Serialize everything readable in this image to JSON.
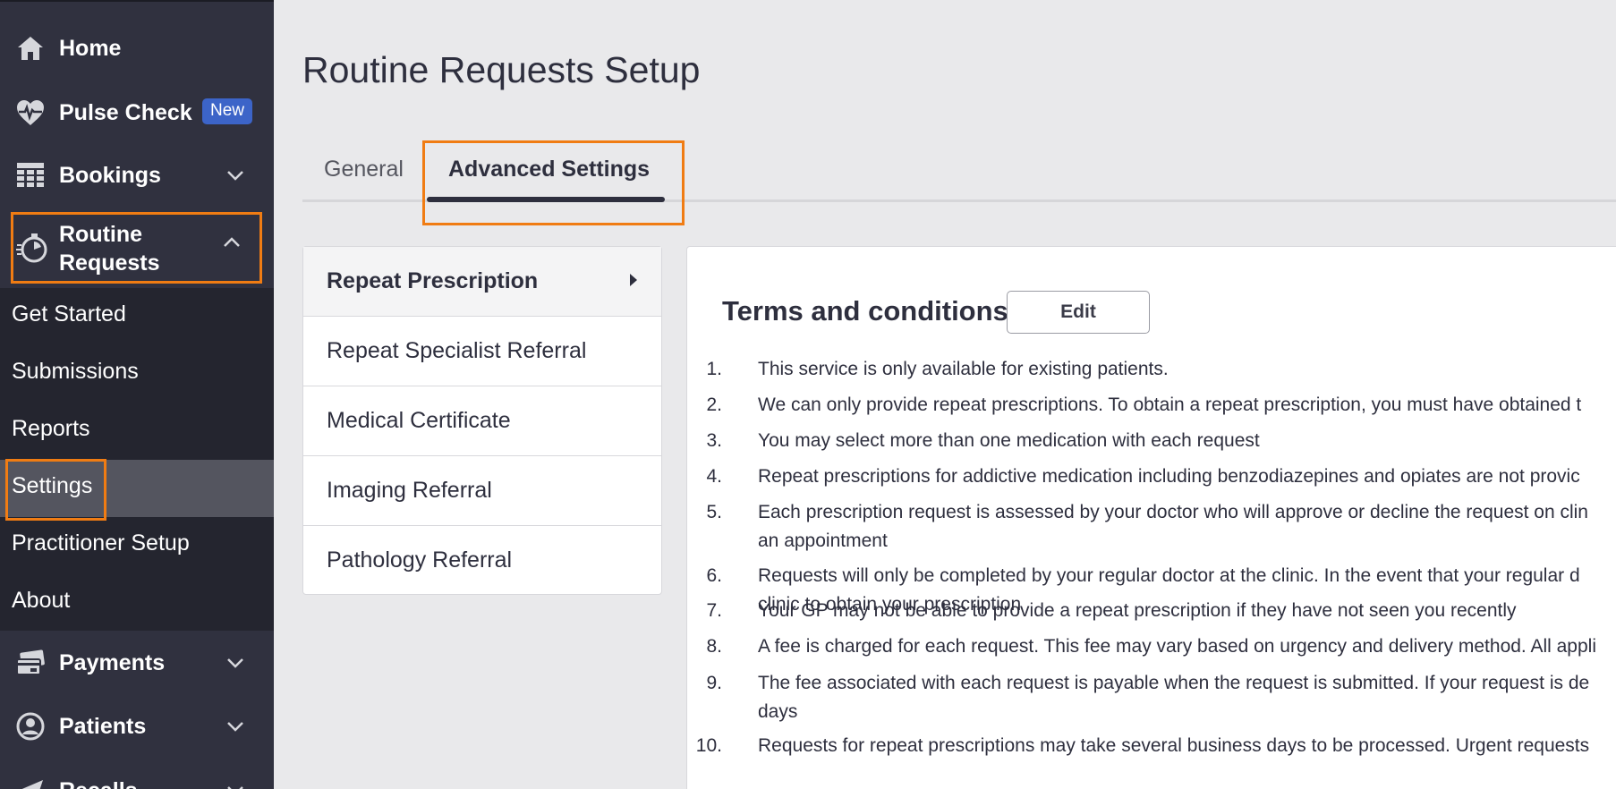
{
  "sidebar": {
    "items": [
      {
        "label": "Home",
        "icon": "home-icon"
      },
      {
        "label": "Pulse Check",
        "icon": "heart-pulse-icon",
        "badge": "New"
      },
      {
        "label": "Bookings",
        "icon": "calendar-grid-icon"
      },
      {
        "label": "Routine Requests",
        "icon": "stopwatch-icon"
      },
      {
        "label": "Payments",
        "icon": "card-icon"
      },
      {
        "label": "Patients",
        "icon": "user-circle-icon"
      },
      {
        "label": "Recalls",
        "icon": "send-icon"
      }
    ],
    "routine_label_line1": "Routine",
    "routine_label_line2": "Requests",
    "submenu": [
      {
        "label": "Get Started"
      },
      {
        "label": "Submissions"
      },
      {
        "label": "Reports"
      },
      {
        "label": "Settings",
        "active": true
      },
      {
        "label": "Practitioner Setup"
      },
      {
        "label": "About"
      }
    ]
  },
  "main": {
    "title": "Routine Requests Setup",
    "tabs": [
      {
        "label": "General"
      },
      {
        "label": "Advanced Settings",
        "active": true
      }
    ],
    "request_types": [
      {
        "label": "Repeat Prescription",
        "active": true
      },
      {
        "label": "Repeat Specialist Referral"
      },
      {
        "label": "Medical Certificate"
      },
      {
        "label": "Imaging Referral"
      },
      {
        "label": "Pathology Referral"
      }
    ],
    "terms": {
      "title": "Terms and conditions",
      "edit_label": "Edit",
      "items": [
        {
          "num": "1.",
          "lines": [
            "This service is only available for existing patients."
          ]
        },
        {
          "num": "2.",
          "lines": [
            "We can only provide repeat prescriptions. To obtain a repeat prescription, you must have obtained t"
          ]
        },
        {
          "num": "3.",
          "lines": [
            "You may select more than one medication with each request"
          ]
        },
        {
          "num": "4.",
          "lines": [
            "Repeat prescriptions for addictive medication including benzodiazepines and opiates are not provic"
          ]
        },
        {
          "num": "5.",
          "lines": [
            "Each prescription request is assessed by your doctor who will approve or decline the request on clin",
            "an appointment"
          ]
        },
        {
          "num": "6.",
          "lines": [
            "Requests will only be completed by your regular doctor at the clinic. In the event that your regular d",
            "clinic to obtain your prescription"
          ]
        },
        {
          "num": "7.",
          "lines": [
            "Your GP may not be able to provide a repeat prescription if they have not seen you recently"
          ]
        },
        {
          "num": "8.",
          "lines": [
            "A fee is charged for each request. This fee may vary based on urgency and delivery method. All appli"
          ]
        },
        {
          "num": "9.",
          "lines": [
            "The fee associated with each request is payable when the request is submitted. If your request is de",
            "days"
          ]
        },
        {
          "num": "10.",
          "lines": [
            "Requests for repeat prescriptions may take several business days to be processed. Urgent requests"
          ]
        }
      ]
    }
  },
  "colors": {
    "sidebar_bg": "#30313f",
    "submenu_bg": "#24252f",
    "highlight": "#f07c13",
    "badge": "#3c64c8"
  }
}
